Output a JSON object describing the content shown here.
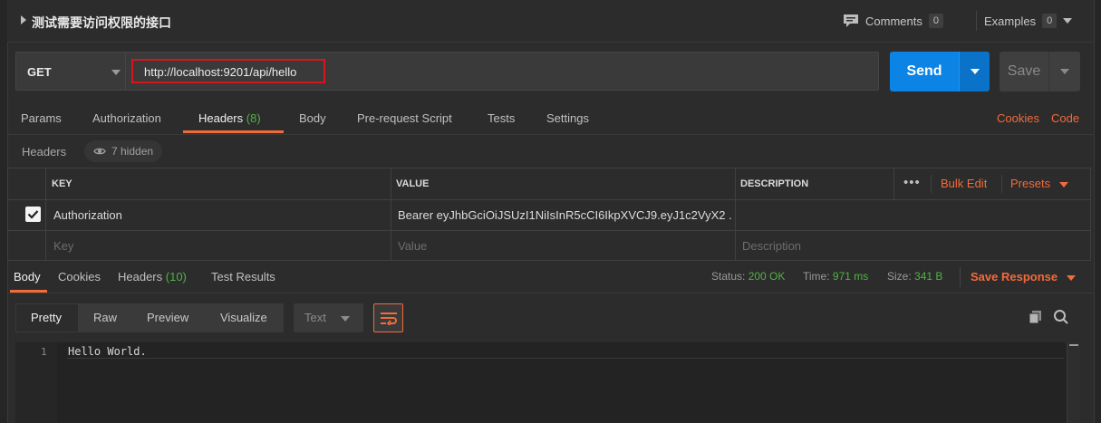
{
  "request": {
    "title": "测试需要访问权限的接口",
    "comments_label": "Comments",
    "comments_count": "0",
    "examples_label": "Examples",
    "examples_count": "0"
  },
  "url_bar": {
    "method": "GET",
    "url": "http://localhost:9201/api/hello",
    "send_label": "Send",
    "save_label": "Save"
  },
  "request_tabs": {
    "items": [
      {
        "label": "Params",
        "count": ""
      },
      {
        "label": "Authorization",
        "count": ""
      },
      {
        "label": "Headers",
        "count": "(8)"
      },
      {
        "label": "Body",
        "count": ""
      },
      {
        "label": "Pre-request Script",
        "count": ""
      },
      {
        "label": "Tests",
        "count": ""
      },
      {
        "label": "Settings",
        "count": ""
      }
    ],
    "active": "Headers",
    "cookies_link": "Cookies",
    "code_link": "Code"
  },
  "headers_section": {
    "label": "Headers",
    "hidden_label": "7 hidden"
  },
  "headers_table": {
    "columns": {
      "key": "KEY",
      "value": "VALUE",
      "description": "DESCRIPTION"
    },
    "bulk_edit": "Bulk Edit",
    "presets": "Presets",
    "rows": [
      {
        "checked": true,
        "key": "Authorization",
        "value": "Bearer eyJhbGciOiJSUzI1NiIsInR5cCI6IkpXVCJ9.eyJ1c2VyX2 ...",
        "description": ""
      }
    ],
    "placeholders": {
      "key": "Key",
      "value": "Value",
      "description": "Description"
    }
  },
  "response_tabs": {
    "items": [
      {
        "label": "Body",
        "count": ""
      },
      {
        "label": "Cookies",
        "count": ""
      },
      {
        "label": "Headers",
        "count": "(10)"
      },
      {
        "label": "Test Results",
        "count": ""
      }
    ],
    "active": "Body"
  },
  "response_meta": {
    "status_label": "Status:",
    "status_value": "200 OK",
    "time_label": "Time:",
    "time_value": "971 ms",
    "size_label": "Size:",
    "size_value": "341 B",
    "save_response": "Save Response"
  },
  "body_toolbar": {
    "formats": [
      "Pretty",
      "Raw",
      "Preview",
      "Visualize"
    ],
    "active_format": "Pretty",
    "language": "Text"
  },
  "editor": {
    "lines": [
      {
        "number": "1",
        "text": "Hello World."
      }
    ]
  },
  "colors": {
    "accent_orange": "#f26b3a",
    "send_blue": "#0b84e6",
    "success_green": "#4fb443",
    "highlight_red": "#d9141b"
  },
  "icons": {
    "comments": "comment-icon",
    "hidden": "eye-icon",
    "wrap": "wrap-lines-icon",
    "copy": "copy-icon",
    "search": "search-icon"
  }
}
